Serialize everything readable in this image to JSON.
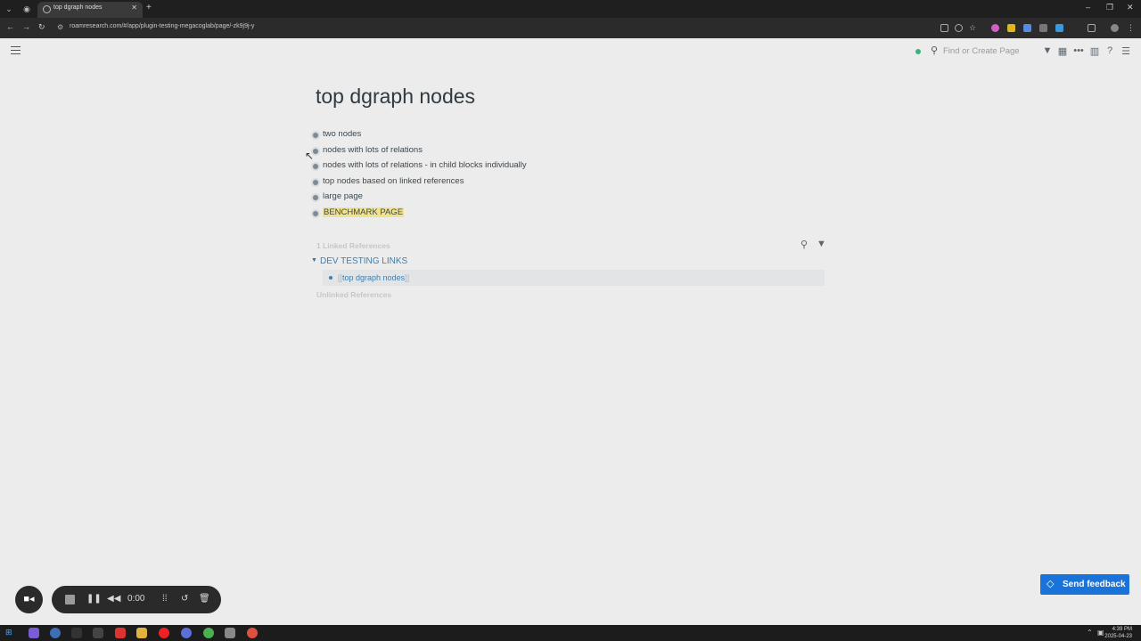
{
  "browser": {
    "tab_title": "top dgraph nodes",
    "new_tab_label": "+",
    "close_tab_label": "✕",
    "url": "roamresearch.com/#/app/plugin-testing-megacoglab/page/-zk9j9j-y",
    "window_controls": [
      "–",
      "❐",
      "✕"
    ]
  },
  "topbar": {
    "search_placeholder": "Find or Create Page",
    "icons": [
      "filter-icon",
      "calendar-icon",
      "more-icon",
      "sidebar-icon",
      "help-icon",
      "right-sidebar-icon"
    ]
  },
  "page": {
    "title": "top dgraph nodes",
    "blocks": [
      {
        "text": "two nodes"
      },
      {
        "text": "nodes with lots of relations"
      },
      {
        "text": "nodes with lots of relations - in child blocks individually"
      },
      {
        "text": "top nodes based on linked references"
      },
      {
        "text": "large page"
      },
      {
        "text": "BENCHMARK PAGE"
      }
    ]
  },
  "references": {
    "linked_header": "1 Linked References",
    "group_name": "DEV TESTING LINKS",
    "ref_open": "[[",
    "ref_link": "top dgraph nodes",
    "ref_close": "]]",
    "unlinked_header": "Unlinked References"
  },
  "feedback": {
    "label": "Send feedback"
  },
  "recorder": {
    "time": "0:00"
  },
  "taskbar": {
    "time": "4:39 PM",
    "date": "2025-04-23"
  },
  "colors": {
    "accent": "#1a73d8",
    "link": "#3d7fb0",
    "highlight": "#f1e38b",
    "sync": "#3bb27b"
  }
}
